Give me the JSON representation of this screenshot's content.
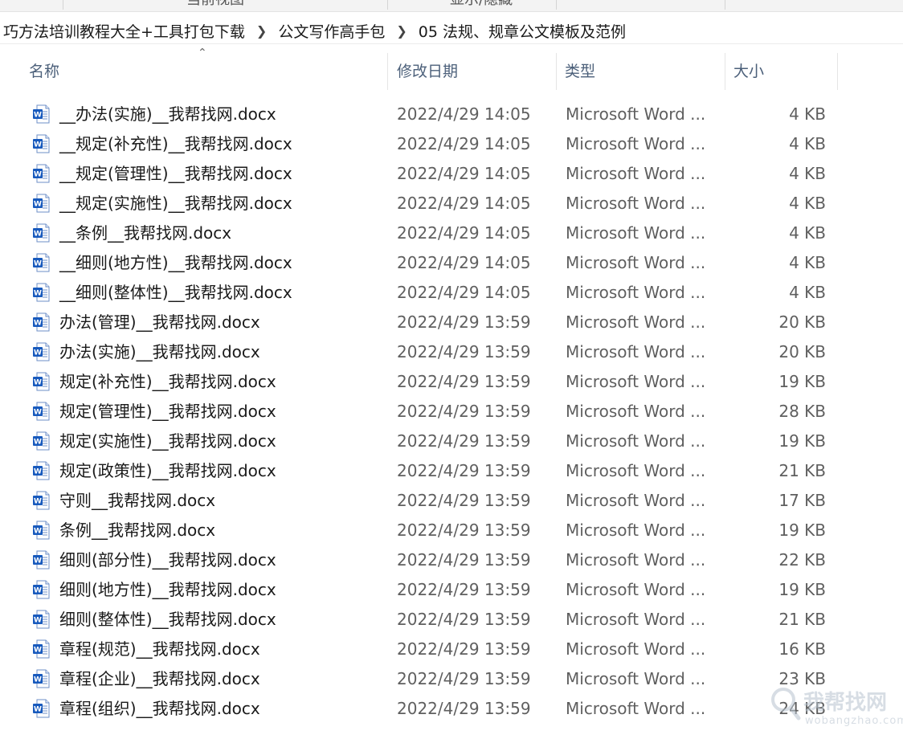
{
  "ribbon": {
    "left_label": "当前视图",
    "right_label": "显示/隐藏"
  },
  "breadcrumb": [
    "巧方法培训教程大全+工具打包下载",
    "公文写作高手包",
    "05 法规、规章公文模板及范例"
  ],
  "columns": {
    "name": "名称",
    "date": "修改日期",
    "type": "类型",
    "size": "大小"
  },
  "sort": {
    "column": "name",
    "icon": "sort-up-icon"
  },
  "file_icon": "word-document-icon",
  "files": [
    {
      "name": "__办法(实施)__我帮找网.docx",
      "date": "2022/4/29 14:05",
      "type": "Microsoft Word ...",
      "size": "4 KB"
    },
    {
      "name": "__规定(补充性)__我帮找网.docx",
      "date": "2022/4/29 14:05",
      "type": "Microsoft Word ...",
      "size": "4 KB"
    },
    {
      "name": "__规定(管理性)__我帮找网.docx",
      "date": "2022/4/29 14:05",
      "type": "Microsoft Word ...",
      "size": "4 KB"
    },
    {
      "name": "__规定(实施性)__我帮找网.docx",
      "date": "2022/4/29 14:05",
      "type": "Microsoft Word ...",
      "size": "4 KB"
    },
    {
      "name": "__条例__我帮找网.docx",
      "date": "2022/4/29 14:05",
      "type": "Microsoft Word ...",
      "size": "4 KB"
    },
    {
      "name": "__细则(地方性)__我帮找网.docx",
      "date": "2022/4/29 14:05",
      "type": "Microsoft Word ...",
      "size": "4 KB"
    },
    {
      "name": "__细则(整体性)__我帮找网.docx",
      "date": "2022/4/29 14:05",
      "type": "Microsoft Word ...",
      "size": "4 KB"
    },
    {
      "name": "办法(管理)__我帮找网.docx",
      "date": "2022/4/29 13:59",
      "type": "Microsoft Word ...",
      "size": "20 KB"
    },
    {
      "name": "办法(实施)__我帮找网.docx",
      "date": "2022/4/29 13:59",
      "type": "Microsoft Word ...",
      "size": "20 KB"
    },
    {
      "name": "规定(补充性)__我帮找网.docx",
      "date": "2022/4/29 13:59",
      "type": "Microsoft Word ...",
      "size": "19 KB"
    },
    {
      "name": "规定(管理性)__我帮找网.docx",
      "date": "2022/4/29 13:59",
      "type": "Microsoft Word ...",
      "size": "28 KB"
    },
    {
      "name": "规定(实施性)__我帮找网.docx",
      "date": "2022/4/29 13:59",
      "type": "Microsoft Word ...",
      "size": "19 KB"
    },
    {
      "name": "规定(政策性)__我帮找网.docx",
      "date": "2022/4/29 13:59",
      "type": "Microsoft Word ...",
      "size": "21 KB"
    },
    {
      "name": "守则__我帮找网.docx",
      "date": "2022/4/29 13:59",
      "type": "Microsoft Word ...",
      "size": "17 KB"
    },
    {
      "name": "条例__我帮找网.docx",
      "date": "2022/4/29 13:59",
      "type": "Microsoft Word ...",
      "size": "19 KB"
    },
    {
      "name": "细则(部分性)__我帮找网.docx",
      "date": "2022/4/29 13:59",
      "type": "Microsoft Word ...",
      "size": "22 KB"
    },
    {
      "name": "细则(地方性)__我帮找网.docx",
      "date": "2022/4/29 13:59",
      "type": "Microsoft Word ...",
      "size": "19 KB"
    },
    {
      "name": "细则(整体性)__我帮找网.docx",
      "date": "2022/4/29 13:59",
      "type": "Microsoft Word ...",
      "size": "21 KB"
    },
    {
      "name": "章程(规范)__我帮找网.docx",
      "date": "2022/4/29 13:59",
      "type": "Microsoft Word ...",
      "size": "16 KB"
    },
    {
      "name": "章程(企业)__我帮找网.docx",
      "date": "2022/4/29 13:59",
      "type": "Microsoft Word ...",
      "size": "23 KB"
    },
    {
      "name": "章程(组织)__我帮找网.docx",
      "date": "2022/4/29 13:59",
      "type": "Microsoft Word ...",
      "size": "24 KB"
    }
  ],
  "watermark": {
    "text": "我帮找网",
    "subtext": "wobangzhao.com"
  },
  "colors": {
    "word_blue": "#185abd",
    "header_text": "#4c607a",
    "meta_text": "#5f5f5f"
  }
}
